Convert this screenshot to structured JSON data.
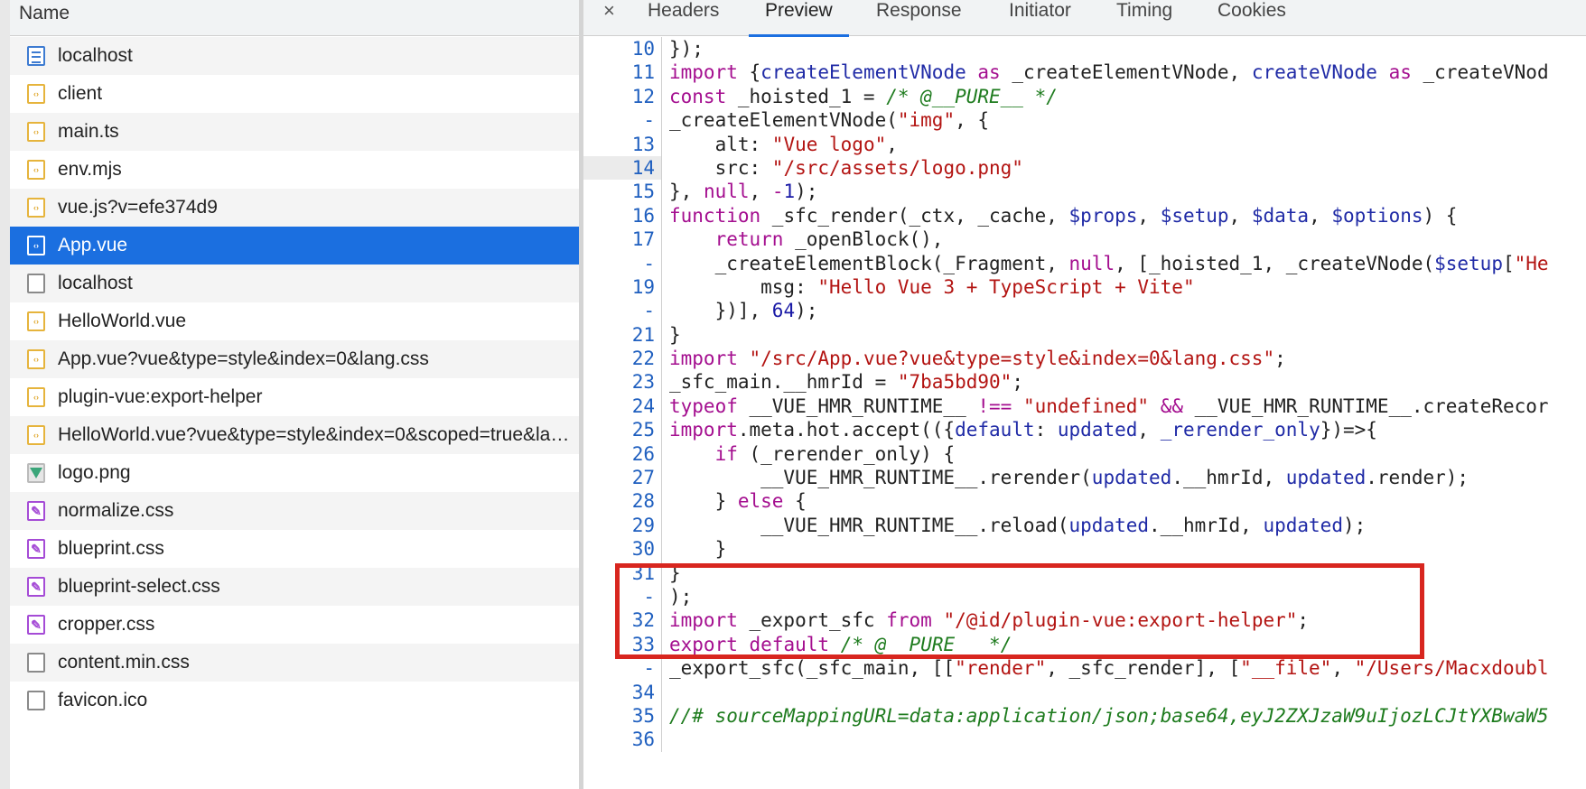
{
  "request_list": {
    "header": "Name",
    "selected_index": 5,
    "items": [
      {
        "label": "localhost",
        "icon": "document-icon"
      },
      {
        "label": "client",
        "icon": "script-icon"
      },
      {
        "label": "main.ts",
        "icon": "script-icon"
      },
      {
        "label": "env.mjs",
        "icon": "script-icon"
      },
      {
        "label": "vue.js?v=efe374d9",
        "icon": "script-icon"
      },
      {
        "label": "App.vue",
        "icon": "script-icon"
      },
      {
        "label": "localhost",
        "icon": "blank-file-icon"
      },
      {
        "label": "HelloWorld.vue",
        "icon": "script-icon"
      },
      {
        "label": "App.vue?vue&type=style&index=0&lang.css",
        "icon": "script-icon"
      },
      {
        "label": "plugin-vue:export-helper",
        "icon": "script-icon"
      },
      {
        "label": "HelloWorld.vue?vue&type=style&index=0&scoped=true&lang.css",
        "icon": "script-icon"
      },
      {
        "label": "logo.png",
        "icon": "image-icon"
      },
      {
        "label": "normalize.css",
        "icon": "stylesheet-icon"
      },
      {
        "label": "blueprint.css",
        "icon": "stylesheet-icon"
      },
      {
        "label": "blueprint-select.css",
        "icon": "stylesheet-icon"
      },
      {
        "label": "cropper.css",
        "icon": "stylesheet-icon"
      },
      {
        "label": "content.min.css",
        "icon": "blank-file-icon"
      },
      {
        "label": "favicon.ico",
        "icon": "blank-file-icon"
      }
    ]
  },
  "detail_tabs": {
    "close": "×",
    "active": "Preview",
    "tabs": [
      "Headers",
      "Preview",
      "Response",
      "Initiator",
      "Timing",
      "Cookies"
    ]
  },
  "colors": {
    "accent": "#1b6fe0",
    "highlight_box": "#d8261f"
  },
  "preview": {
    "highlighted_line": "14",
    "lines": [
      {
        "num": "10",
        "seg": [
          [
            "p",
            "});"
          ]
        ]
      },
      {
        "num": "11",
        "seg": [
          [
            "k",
            "import"
          ],
          [
            "p",
            " {"
          ],
          [
            "v",
            "createElementVNode"
          ],
          [
            "p",
            " "
          ],
          [
            "k",
            "as"
          ],
          [
            "p",
            " _createElementVNode, "
          ],
          [
            "v",
            "createVNode"
          ],
          [
            "p",
            " "
          ],
          [
            "k",
            "as"
          ],
          [
            "p",
            " _createVNod"
          ]
        ]
      },
      {
        "num": "12",
        "seg": [
          [
            "k",
            "const"
          ],
          [
            "p",
            " _hoisted_1 = "
          ],
          [
            "c",
            "/* @__PURE__ */"
          ]
        ]
      },
      {
        "num": "-",
        "seg": [
          [
            "p",
            "_createElementVNode("
          ],
          [
            "s",
            "\"img\""
          ],
          [
            "p",
            ", {"
          ]
        ]
      },
      {
        "num": "13",
        "seg": [
          [
            "p",
            "    alt: "
          ],
          [
            "s",
            "\"Vue logo\""
          ],
          [
            "p",
            ","
          ]
        ]
      },
      {
        "num": "14",
        "seg": [
          [
            "p",
            "    src: "
          ],
          [
            "s",
            "\"/src/assets/logo.png\""
          ]
        ]
      },
      {
        "num": "15",
        "seg": [
          [
            "p",
            "}, "
          ],
          [
            "k",
            "null"
          ],
          [
            "p",
            ", "
          ],
          [
            "k",
            "-"
          ],
          [
            "n",
            "1"
          ],
          [
            "p",
            ");"
          ]
        ]
      },
      {
        "num": "16",
        "seg": [
          [
            "k",
            "function"
          ],
          [
            "p",
            " _sfc_render(_ctx, _cache, "
          ],
          [
            "v",
            "$props"
          ],
          [
            "p",
            ", "
          ],
          [
            "v",
            "$setup"
          ],
          [
            "p",
            ", "
          ],
          [
            "v",
            "$data"
          ],
          [
            "p",
            ", "
          ],
          [
            "v",
            "$options"
          ],
          [
            "p",
            ") {"
          ]
        ]
      },
      {
        "num": "17",
        "seg": [
          [
            "p",
            "    "
          ],
          [
            "k",
            "return"
          ],
          [
            "p",
            " _openBlock(),"
          ]
        ]
      },
      {
        "num": "-",
        "seg": [
          [
            "p",
            "    _createElementBlock(_Fragment, "
          ],
          [
            "k",
            "null"
          ],
          [
            "p",
            ", [_hoisted_1, _createVNode("
          ],
          [
            "v",
            "$setup"
          ],
          [
            "p",
            "["
          ],
          [
            "s",
            "\"He"
          ]
        ]
      },
      {
        "num": "19",
        "seg": [
          [
            "p",
            "        msg: "
          ],
          [
            "s",
            "\"Hello Vue 3 + TypeScript + Vite\""
          ]
        ]
      },
      {
        "num": "-",
        "seg": [
          [
            "p",
            "    })], "
          ],
          [
            "n",
            "64"
          ],
          [
            "p",
            ");"
          ]
        ]
      },
      {
        "num": "21",
        "seg": [
          [
            "p",
            "}"
          ]
        ]
      },
      {
        "num": "22",
        "seg": [
          [
            "k",
            "import"
          ],
          [
            "p",
            " "
          ],
          [
            "s",
            "\"/src/App.vue?vue&type=style&index=0&lang.css\""
          ],
          [
            "p",
            ";"
          ]
        ]
      },
      {
        "num": "23",
        "seg": [
          [
            "p",
            "_sfc_main.__hmrId = "
          ],
          [
            "s",
            "\"7ba5bd90\""
          ],
          [
            "p",
            ";"
          ]
        ]
      },
      {
        "num": "24",
        "seg": [
          [
            "k",
            "typeof"
          ],
          [
            "p",
            " __VUE_HMR_RUNTIME__ "
          ],
          [
            "k",
            "!=="
          ],
          [
            "p",
            " "
          ],
          [
            "s",
            "\"undefined\""
          ],
          [
            "p",
            " "
          ],
          [
            "k",
            "&&"
          ],
          [
            "p",
            " __VUE_HMR_RUNTIME__.createRecor"
          ]
        ]
      },
      {
        "num": "25",
        "seg": [
          [
            "k",
            "import"
          ],
          [
            "p",
            ".meta.hot.accept(({"
          ],
          [
            "v",
            "default"
          ],
          [
            "p",
            ": "
          ],
          [
            "v",
            "updated"
          ],
          [
            "p",
            ", "
          ],
          [
            "v",
            "_rerender_only"
          ],
          [
            "p",
            "})=>{"
          ]
        ]
      },
      {
        "num": "26",
        "seg": [
          [
            "p",
            "    "
          ],
          [
            "k",
            "if"
          ],
          [
            "p",
            " (_rerender_only) {"
          ]
        ]
      },
      {
        "num": "27",
        "seg": [
          [
            "p",
            "        __VUE_HMR_RUNTIME__.rerender("
          ],
          [
            "v",
            "updated"
          ],
          [
            "p",
            ".__hmrId, "
          ],
          [
            "v",
            "updated"
          ],
          [
            "p",
            ".render);"
          ]
        ]
      },
      {
        "num": "28",
        "seg": [
          [
            "p",
            "    } "
          ],
          [
            "k",
            "else"
          ],
          [
            "p",
            " {"
          ]
        ]
      },
      {
        "num": "29",
        "seg": [
          [
            "p",
            "        __VUE_HMR_RUNTIME__.reload("
          ],
          [
            "v",
            "updated"
          ],
          [
            "p",
            ".__hmrId, "
          ],
          [
            "v",
            "updated"
          ],
          [
            "p",
            ");"
          ]
        ]
      },
      {
        "num": "30",
        "seg": [
          [
            "p",
            "    }"
          ]
        ]
      },
      {
        "num": "31",
        "seg": [
          [
            "p",
            "}"
          ]
        ]
      },
      {
        "num": "-",
        "seg": [
          [
            "p",
            ");"
          ]
        ]
      },
      {
        "num": "32",
        "seg": [
          [
            "k",
            "import"
          ],
          [
            "p",
            " _export_sfc "
          ],
          [
            "k",
            "from"
          ],
          [
            "p",
            " "
          ],
          [
            "s",
            "\"/@id/plugin-vue:export-helper\""
          ],
          [
            "p",
            ";"
          ]
        ]
      },
      {
        "num": "33",
        "seg": [
          [
            "k",
            "export"
          ],
          [
            "p",
            " "
          ],
          [
            "k",
            "default"
          ],
          [
            "p",
            " "
          ],
          [
            "c",
            "/* @__PURE__ */"
          ]
        ]
      },
      {
        "num": "-",
        "seg": [
          [
            "p",
            "_export_sfc(_sfc_main, [["
          ],
          [
            "s",
            "\"render\""
          ],
          [
            "p",
            ", _sfc_render], ["
          ],
          [
            "s",
            "\"__file\""
          ],
          [
            "p",
            ", "
          ],
          [
            "s",
            "\"/Users/Macxdoubl"
          ]
        ]
      },
      {
        "num": "34",
        "seg": []
      },
      {
        "num": "35",
        "seg": [
          [
            "c",
            "//# sourceMappingURL=data:application/json;base64,eyJ2ZXJzaW9uIjozLCJtYXBwaW5"
          ]
        ]
      },
      {
        "num": "36",
        "seg": []
      }
    ]
  }
}
